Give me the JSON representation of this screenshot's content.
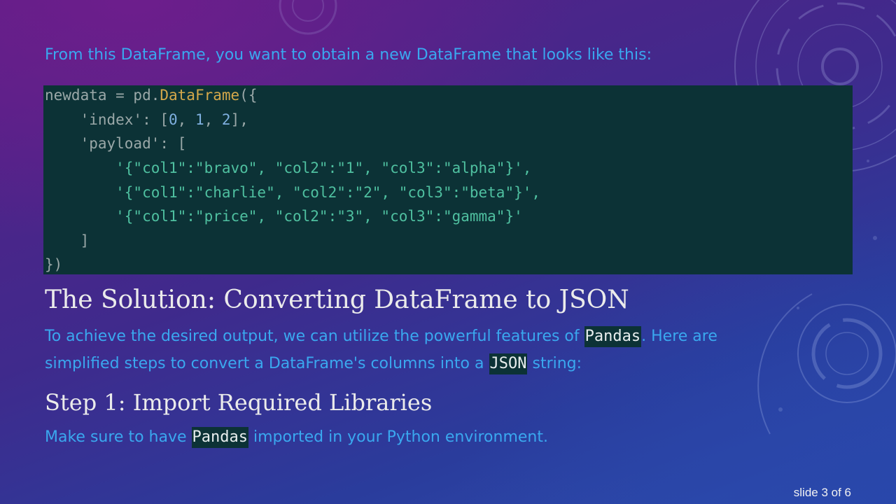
{
  "slide": {
    "intro": "From this DataFrame, you want to obtain a new DataFrame that looks like this:",
    "code": {
      "line1_var": "newdata = pd.",
      "line1_cls": "DataFrame",
      "line1_end": "({",
      "line2_key": "    'index': [",
      "line2_n0": "0",
      "line2_sep1": ", ",
      "line2_n1": "1",
      "line2_sep2": ", ",
      "line2_n2": "2",
      "line2_end": "],",
      "line3": "    'payload': [",
      "line4": "        '{\"col1\":\"bravo\", \"col2\":\"1\", \"col3\":\"alpha\"}',",
      "line5": "        '{\"col1\":\"charlie\", \"col2\":\"2\", \"col3\":\"beta\"}',",
      "line6": "        '{\"col1\":\"price\", \"col2\":\"3\", \"col3\":\"gamma\"}'",
      "line7": "    ]",
      "line8": "})"
    },
    "solution_heading": "The Solution: Converting DataFrame to JSON",
    "para1": {
      "pre": "To achieve the desired output, we can utilize the powerful features of ",
      "code": "Pandas",
      "post": ". Here are"
    },
    "para2": {
      "pre": "simplified steps to convert a DataFrame's columns into a ",
      "code": "JSON",
      "post": " string:"
    },
    "step1_heading": "Step 1: Import Required Libraries",
    "para3": {
      "pre": "Make sure to have ",
      "code": "Pandas",
      "post": " imported in your Python environment."
    },
    "footer": "slide 3 of 6"
  }
}
